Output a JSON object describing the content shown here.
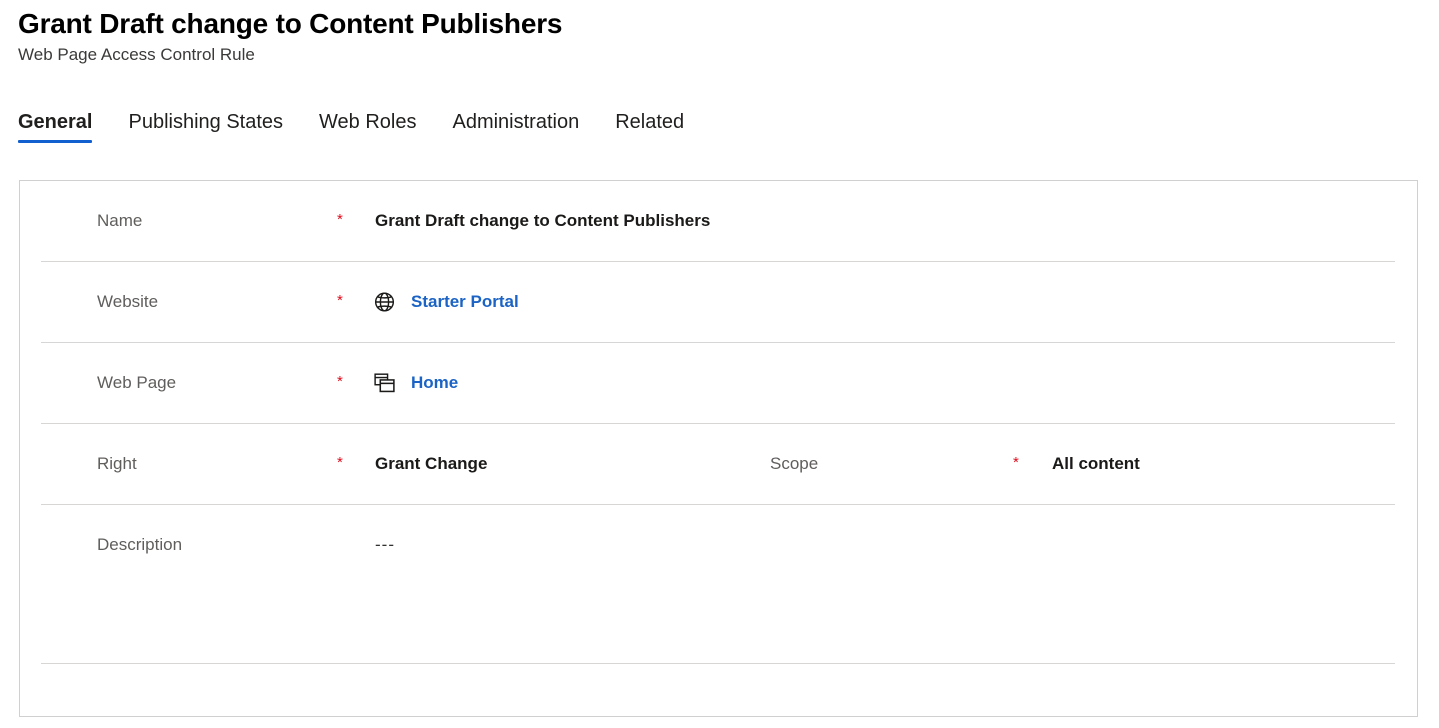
{
  "header": {
    "title": "Grant Draft change to Content Publishers",
    "subtitle": "Web Page Access Control Rule"
  },
  "tabs": [
    {
      "label": "General",
      "active": true
    },
    {
      "label": "Publishing States",
      "active": false
    },
    {
      "label": "Web Roles",
      "active": false
    },
    {
      "label": "Administration",
      "active": false
    },
    {
      "label": "Related",
      "active": false
    }
  ],
  "form": {
    "rows": [
      {
        "label": "Name",
        "required_marker": "*",
        "value": "Grant Draft change to Content Publishers"
      },
      {
        "label": "Website",
        "required_marker": "*",
        "value": "Starter Portal",
        "icon": "globe-icon"
      },
      {
        "label": "Web Page",
        "required_marker": "*",
        "value": "Home",
        "icon": "web-page-icon"
      },
      {
        "label": "Right",
        "required_marker": "*",
        "value": "Grant Change",
        "second_label": "Scope",
        "second_required_marker": "*",
        "second_value": "All content"
      },
      {
        "label": "Description",
        "required_marker": "",
        "value": "---"
      }
    ]
  },
  "colors": {
    "accent": "#1260cf",
    "link": "#1b63c4",
    "required": "#e00b1c",
    "label": "#605e5c",
    "border": "#d2d0ce"
  }
}
